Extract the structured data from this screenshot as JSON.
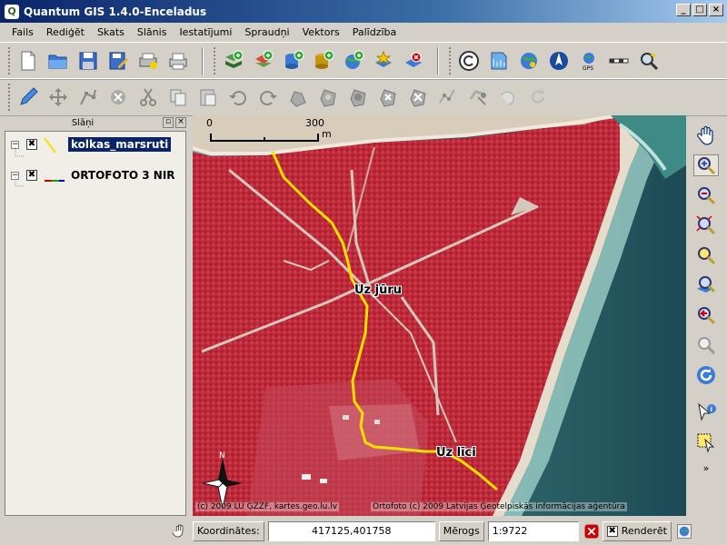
{
  "window": {
    "title": "Quantum GIS 1.4.0-Enceladus",
    "controls": [
      "minimize",
      "maximize",
      "close"
    ]
  },
  "menu": [
    "Fails",
    "Rediģēt",
    "Skats",
    "Slānis",
    "Iestatījumi",
    "Spraudņi",
    "Vektors",
    "Palīdzība"
  ],
  "toolbar_icons": {
    "file": [
      "new-project-icon",
      "open-project-icon",
      "save-project-icon",
      "save-as-icon",
      "print-composer-icon",
      "print-icon"
    ],
    "layers": [
      "add-vector-layer-icon",
      "add-raster-layer-icon",
      "add-postgis-layer-icon",
      "add-spatialite-layer-icon",
      "add-wms-layer-icon",
      "new-vector-layer-icon",
      "remove-layer-icon"
    ],
    "plugins": [
      "copyright-label-icon",
      "north-arrow-plugin-icon",
      "gps-icon",
      "north-arrow-icon",
      "georeferencer-icon",
      "scalebar-icon",
      "identify-plugin-icon"
    ],
    "digitizing": [
      "toggle-edit-icon",
      "move-feature-icon",
      "node-tool-icon",
      "delete-selected-icon",
      "cut-features-icon",
      "copy-features-icon",
      "paste-features-icon",
      "undo-icon",
      "redo-icon",
      "simplify-icon",
      "add-ring-icon",
      "add-island-icon",
      "delete-ring-icon",
      "delete-part-icon",
      "reshape-icon",
      "split-features-icon",
      "merge-features-icon",
      "rotate-icon"
    ],
    "map_navigation": [
      "pan-icon",
      "zoom-in-icon",
      "zoom-out-icon",
      "zoom-full-icon",
      "zoom-selection-icon",
      "zoom-layer-icon",
      "zoom-last-icon",
      "zoom-actual-icon",
      "refresh-icon",
      "identify-icon",
      "select-icon",
      "more-icon"
    ]
  },
  "layers_panel": {
    "title": "Slāņi",
    "layers": [
      {
        "name": "kolkas_marsruti",
        "checked": true,
        "selected": true,
        "symbol_color": "#f2e000"
      },
      {
        "name": "ORTOFOTO 3 NIR",
        "checked": true,
        "selected": false,
        "symbol_color": "#cc0000"
      }
    ]
  },
  "map": {
    "scalebar": {
      "start": "0",
      "end": "300",
      "unit": "m"
    },
    "labels": [
      "Uz jūru",
      "Uz līci"
    ],
    "copyright_left": "(c) 2009 LU ĢZZF, kartes.geo.lu.lv",
    "copyright_right": "Ortofoto (c) 2009 Latvijas Ģeotelpiskās informācijas aģentūra",
    "route_color": "#f7e000",
    "forest_color": "#c32a3a",
    "sea_color": "#2d6b6a"
  },
  "statusbar": {
    "coord_label": "Koordinātes:",
    "coord_value": "417125,401758",
    "scale_label": "Mērogs",
    "scale_value": "1:9722",
    "render_label": "Renderēt"
  }
}
